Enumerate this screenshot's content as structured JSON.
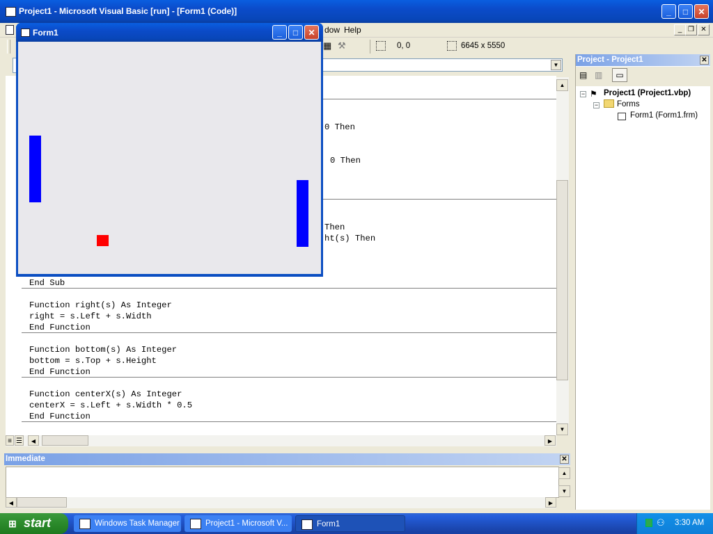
{
  "main_window": {
    "title": "Project1 - Microsoft Visual Basic [run] - [Form1 (Code)]"
  },
  "menu": {
    "items": [
      "Window",
      "Help"
    ],
    "visible_fragment": "dow"
  },
  "toolbar": {
    "position": "0, 0",
    "size": "6645 x 5550"
  },
  "code": {
    "fragments": [
      {
        "text": "0 Then"
      },
      {
        "text": "0 Then"
      },
      {
        "text": "Then"
      },
      {
        "text": "ht(s) Then"
      }
    ],
    "lines": [
      "End Sub",
      "Function right(s) As Integer",
      "right = s.Left + s.Width",
      "End Function",
      "Function bottom(s) As Integer",
      "bottom = s.Top + s.Height",
      "End Function",
      "Function centerX(s) As Integer",
      "centerX = s.Left + s.Width * 0.5",
      "End Function"
    ]
  },
  "project_explorer": {
    "title": "Project - Project1",
    "root": "Project1 (Project1.vbp)",
    "folder": "Forms",
    "form": "Form1 (Form1.frm)"
  },
  "immediate": {
    "title": "Immediate",
    "content": ""
  },
  "form1": {
    "title": "Form1",
    "colors": {
      "paddle": "#0000ff",
      "ball": "#ff0000"
    }
  },
  "taskbar": {
    "start_label": "start",
    "tasks": [
      {
        "label": "Windows Task Manager",
        "active": false
      },
      {
        "label": "Project1 - Microsoft V...",
        "active": false
      },
      {
        "label": "Form1",
        "active": true
      }
    ],
    "clock": "3:30 AM"
  }
}
